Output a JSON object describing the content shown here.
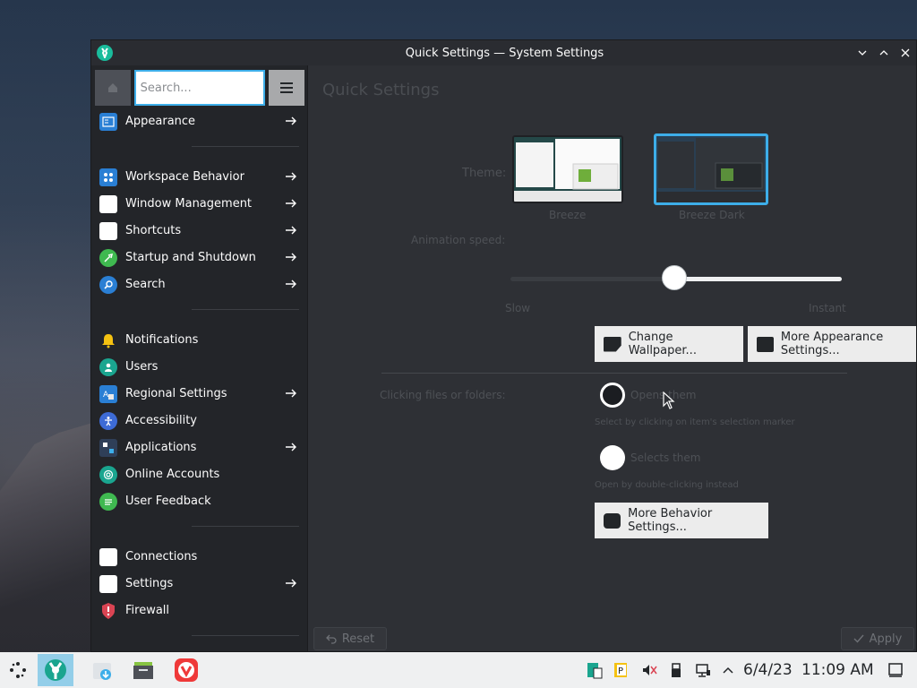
{
  "window": {
    "title": "Quick Settings — System Settings"
  },
  "sidebar": {
    "search_placeholder": "Search...",
    "items": [
      {
        "label": "Appearance",
        "icon": "appearance-icon",
        "arrow": true
      },
      {
        "label": "Workspace Behavior",
        "icon": "workspace-behavior-icon",
        "arrow": true
      },
      {
        "label": "Window Management",
        "icon": "window-management-icon",
        "arrow": true
      },
      {
        "label": "Shortcuts",
        "icon": "shortcuts-icon",
        "arrow": true
      },
      {
        "label": "Startup and Shutdown",
        "icon": "startup-shutdown-icon",
        "arrow": true
      },
      {
        "label": "Search",
        "icon": "search-icon",
        "arrow": true
      },
      {
        "label": "Notifications",
        "icon": "bell-icon",
        "arrow": false
      },
      {
        "label": "Users",
        "icon": "users-icon",
        "arrow": false
      },
      {
        "label": "Regional Settings",
        "icon": "regional-icon",
        "arrow": true
      },
      {
        "label": "Accessibility",
        "icon": "accessibility-icon",
        "arrow": false
      },
      {
        "label": "Applications",
        "icon": "applications-icon",
        "arrow": true
      },
      {
        "label": "Online Accounts",
        "icon": "online-accounts-icon",
        "arrow": false
      },
      {
        "label": "User Feedback",
        "icon": "feedback-icon",
        "arrow": false
      },
      {
        "label": "Connections",
        "icon": "connections-icon",
        "arrow": false
      },
      {
        "label": "Settings",
        "icon": "settings-icon",
        "arrow": true
      },
      {
        "label": "Firewall",
        "icon": "firewall-icon",
        "arrow": false
      }
    ]
  },
  "main": {
    "page_title": "Quick Settings",
    "theme_label": "Theme:",
    "themes": [
      {
        "name": "Breeze",
        "selected": false
      },
      {
        "name": "Breeze Dark",
        "selected": true
      }
    ],
    "animation_label": "Animation speed:",
    "animation_speed_fraction": 0.5,
    "slider_min_label": "Slow",
    "slider_max_label": "Instant",
    "change_wallpaper": "Change Wallpaper...",
    "more_appearance": "More Appearance Settings...",
    "clicking_label": "Clicking files or folders:",
    "option_open": "Opens them",
    "option_open_hint": "Select by clicking on item's selection marker",
    "option_select": "Selects them",
    "option_select_hint": "Open by double-clicking instead",
    "more_behavior": "More Behavior Settings...",
    "reset": "Reset",
    "apply": "Apply"
  },
  "taskbar": {
    "date": "6/4/23",
    "time": "11:09 AM"
  },
  "colors": {
    "accent": "#3daee9",
    "window_bg": "#2e3035",
    "sidebar_bg": "#232529",
    "taskbar_bg": "#eff0f1"
  }
}
